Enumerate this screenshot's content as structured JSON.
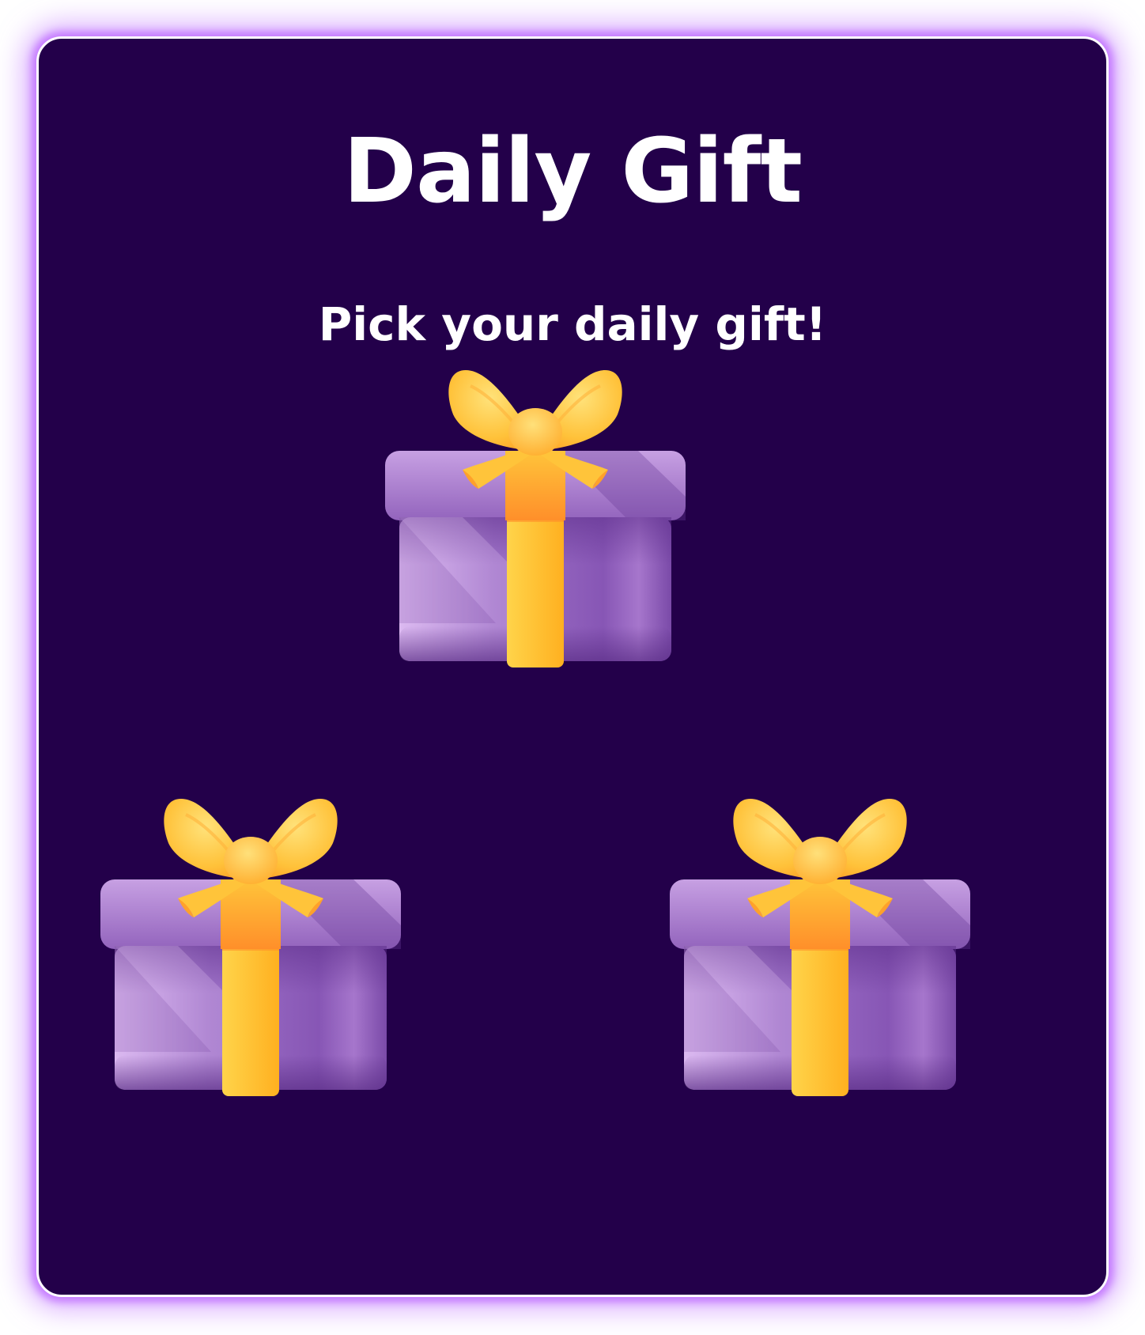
{
  "dialog": {
    "title": "Daily Gift",
    "subtitle": "Pick your daily gift!"
  },
  "gifts": [
    {
      "icon": "gift-box-icon",
      "position": "top"
    },
    {
      "icon": "gift-box-icon",
      "position": "bottom-left"
    },
    {
      "icon": "gift-box-icon",
      "position": "bottom-right"
    }
  ],
  "colors": {
    "background": "#23004a",
    "border": "#ffffff",
    "glow": "#c478ff",
    "text": "#ffffff",
    "box_purple": "#9a6bc4",
    "ribbon_yellow": "#ffc533"
  }
}
